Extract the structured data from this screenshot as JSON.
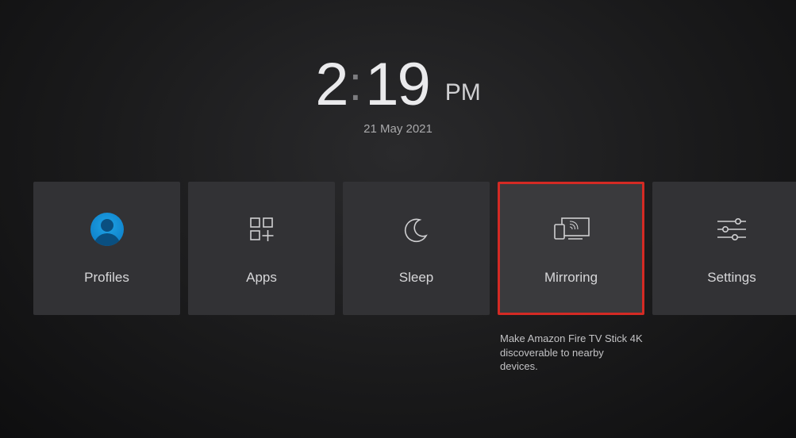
{
  "clock": {
    "hour": "2",
    "colon": ":",
    "minute": "19",
    "ampm": "PM",
    "date": "21 May 2021"
  },
  "tiles": {
    "profiles": {
      "label": "Profiles"
    },
    "apps": {
      "label": "Apps"
    },
    "sleep": {
      "label": "Sleep"
    },
    "mirroring": {
      "label": "Mirroring"
    },
    "settings": {
      "label": "Settings"
    }
  },
  "selected_description": "Make Amazon Fire TV Stick 4K discoverable to nearby devices."
}
